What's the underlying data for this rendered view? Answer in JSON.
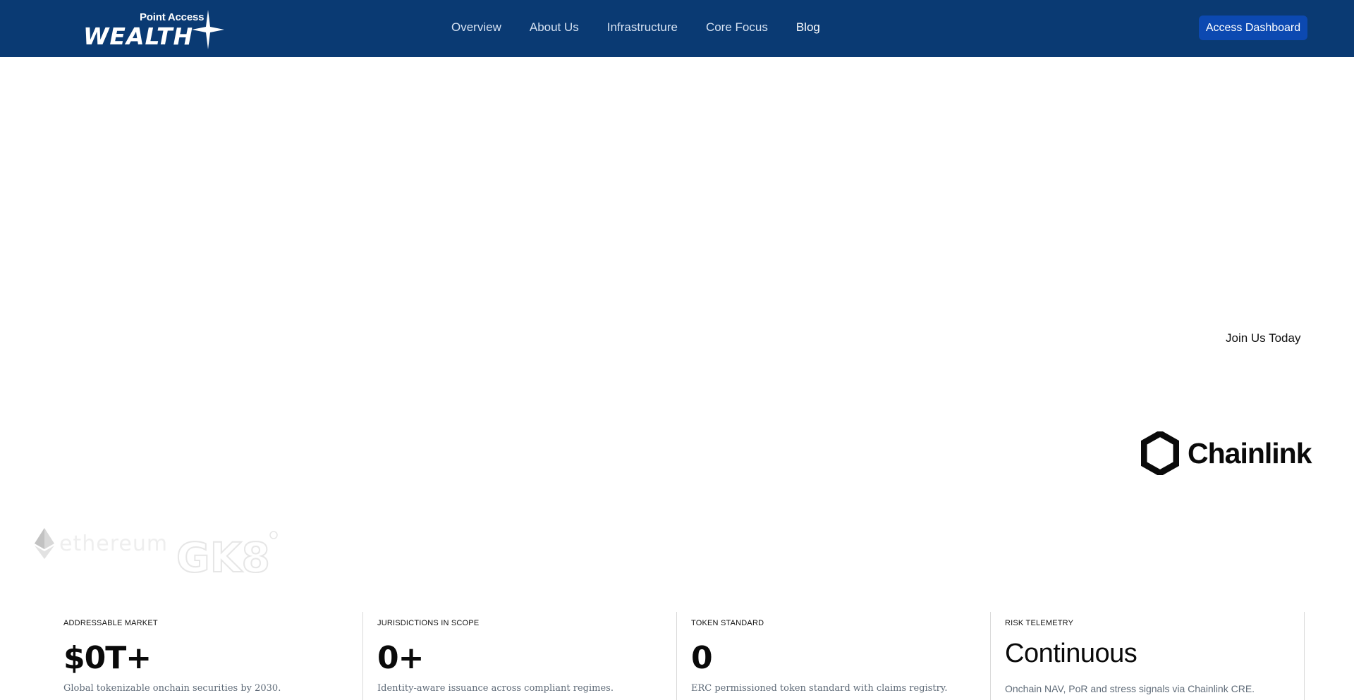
{
  "header": {
    "logo": {
      "top_text": "Point Access",
      "main_text": "WEALTH"
    },
    "nav": [
      {
        "label": "Overview"
      },
      {
        "label": "About Us"
      },
      {
        "label": "Infrastructure"
      },
      {
        "label": "Core Focus"
      },
      {
        "label": "Blog"
      }
    ],
    "cta_label": "Access Dashboard"
  },
  "hero": {
    "join_label": "Join Us Today"
  },
  "partners": {
    "chainlink": "Chainlink",
    "ethereum": "ethereum",
    "gk8": "GK8"
  },
  "stats": [
    {
      "label": "ADDRESSABLE MARKET",
      "value": "$0T+",
      "desc": "Global tokenizable onchain securities by 2030."
    },
    {
      "label": "JURISDICTIONS IN SCOPE",
      "value": "0+",
      "desc": "Identity-aware issuance across compliant regimes."
    },
    {
      "label": "TOKEN STANDARD",
      "value": "0",
      "desc": "ERC permissioned token standard with claims registry."
    },
    {
      "label": "RISK TELEMETRY",
      "value": "Continuous",
      "desc": "Onchain NAV, PoR and stress signals via Chainlink CRE."
    }
  ],
  "colors": {
    "navbar_bg": "#0a3a73",
    "cta_bg": "#0c49b1",
    "nav_text": "#d6e2f2"
  },
  "icons": [
    "sparkle-star-icon",
    "chainlink-hexagon-icon",
    "ethereum-diamond-icon"
  ]
}
